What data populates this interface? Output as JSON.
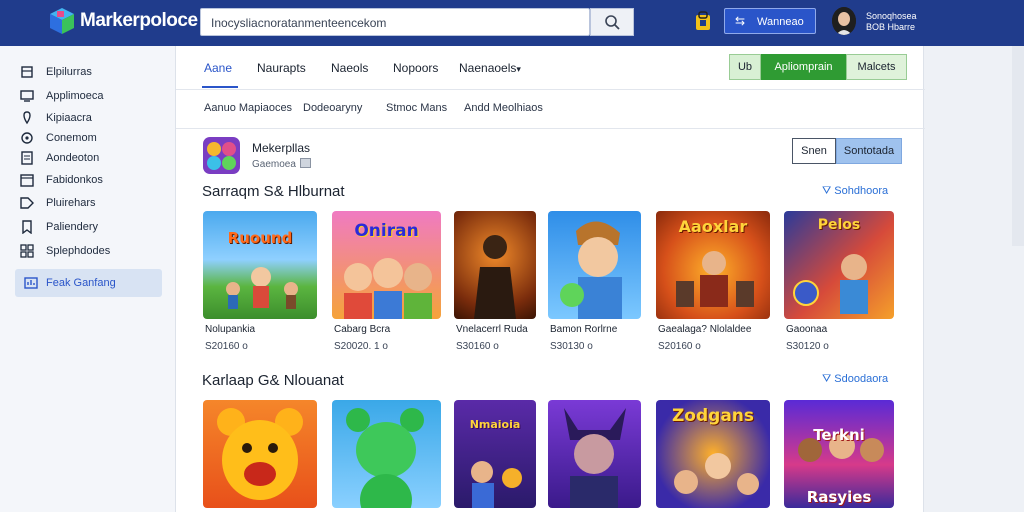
{
  "header": {
    "brand": "Markerpoloce",
    "search_value": "Inocysliacnoratanmenteencekom",
    "sell_label": "Wanneao",
    "user_line1": "Sonoqhosea",
    "user_line2": "BOB Hbarre",
    "colors": {
      "bar": "#203c8c",
      "sell": "#2a55c9"
    }
  },
  "sidebar": {
    "items": [
      {
        "label": "Elpilurras",
        "icon": "box-icon"
      },
      {
        "label": "Applimoeca",
        "icon": "monitor-icon"
      },
      {
        "label": "Kipiaacra",
        "icon": "pin-icon"
      },
      {
        "label": "Conemom",
        "icon": "gear-icon"
      },
      {
        "label": "Aondeoton",
        "icon": "document-icon"
      },
      {
        "label": "Fabidonkos",
        "icon": "calendar-icon"
      },
      {
        "label": "Pluirehars",
        "icon": "tag-icon"
      },
      {
        "label": "Paliendery",
        "icon": "bookmark-icon"
      },
      {
        "label": "Splephdodes",
        "icon": "grid-icon"
      },
      {
        "label": "Feak Ganfang",
        "icon": "chart-icon"
      }
    ]
  },
  "tabs": [
    "Aane",
    "Naurapts",
    "Naeols",
    "Nopoors",
    "Naenaoels"
  ],
  "toolbar": {
    "mini": "Ub",
    "primary": "Apliomprain",
    "secondary": "Malcets"
  },
  "subtabs": [
    "Aanuo Mapiaoces",
    "Dodeoaryny",
    "Stmoc Mans",
    "Andd Meolhiaos"
  ],
  "app": {
    "title": "Mekerpllas",
    "subtitle": "Gaemoea"
  },
  "segments": [
    "Snen",
    "Sontotada"
  ],
  "sections": [
    {
      "title": "Sarraqm S& Hlburnat",
      "link": "Sohdhoora",
      "cards": [
        {
          "name": "Nolupankia",
          "price": "S20160  o",
          "art": "Ruound"
        },
        {
          "name": "Cabarg Bcra",
          "price": "S20020.  1 o",
          "art": "Oniran"
        },
        {
          "name": "Vnelacerrl Ruda",
          "price": "S30160  o",
          "art": ""
        },
        {
          "name": "Bamon Rorlrne",
          "price": "S30130  o",
          "art": ""
        },
        {
          "name": "Gaealaga? Nlolaldee",
          "price": "S20160  o",
          "art": "Aaoxlar"
        },
        {
          "name": "Gaoonaa",
          "price": "S30120  o",
          "art": "Pelos"
        }
      ]
    },
    {
      "title": "Karlaap G& Nlouanat",
      "link": "Sdoodaora",
      "cards": [
        {
          "name": "",
          "price": "",
          "art": ""
        },
        {
          "name": "",
          "price": "",
          "art": ""
        },
        {
          "name": "",
          "price": "",
          "art": "Nmaioia"
        },
        {
          "name": "",
          "price": "",
          "art": ""
        },
        {
          "name": "",
          "price": "",
          "art": "Zodgans"
        },
        {
          "name": "",
          "price": "",
          "art": "Terkni Rasyies"
        }
      ]
    }
  ]
}
